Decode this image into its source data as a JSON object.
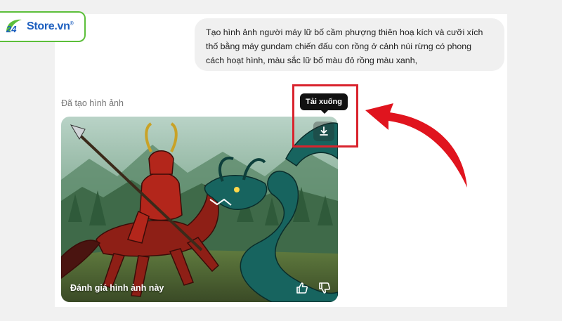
{
  "logo": {
    "number": "24",
    "name": "Store.vn",
    "mark": "®"
  },
  "prompt": {
    "lines": [
      "Tạo hình ảnh người máy lữ bố cầm phượng thiên hoạ kích và cưỡi xích",
      "thố bằng máy gundam chiến đấu con rồng ở cảnh núi rừng có phong",
      "cách hoạt hình, màu sắc lữ bố màu đỏ rồng màu xanh,"
    ]
  },
  "result": {
    "label": "Đã tạo hình ảnh",
    "rate_label": "Đánh giá hình ảnh này",
    "download_tooltip": "Tải xuống"
  },
  "icons": {
    "download": "download-icon",
    "thumbs_up": "thumbs-up-icon",
    "thumbs_down": "thumbs-down-icon",
    "annotation_arrow": "curved-arrow-icon"
  },
  "colors": {
    "highlight": "#d9232d",
    "bubble_bg": "#f0f0f0",
    "tooltip_bg": "#111111",
    "logo_green": "#5cbf3a",
    "logo_blue": "#1d5fbf"
  }
}
